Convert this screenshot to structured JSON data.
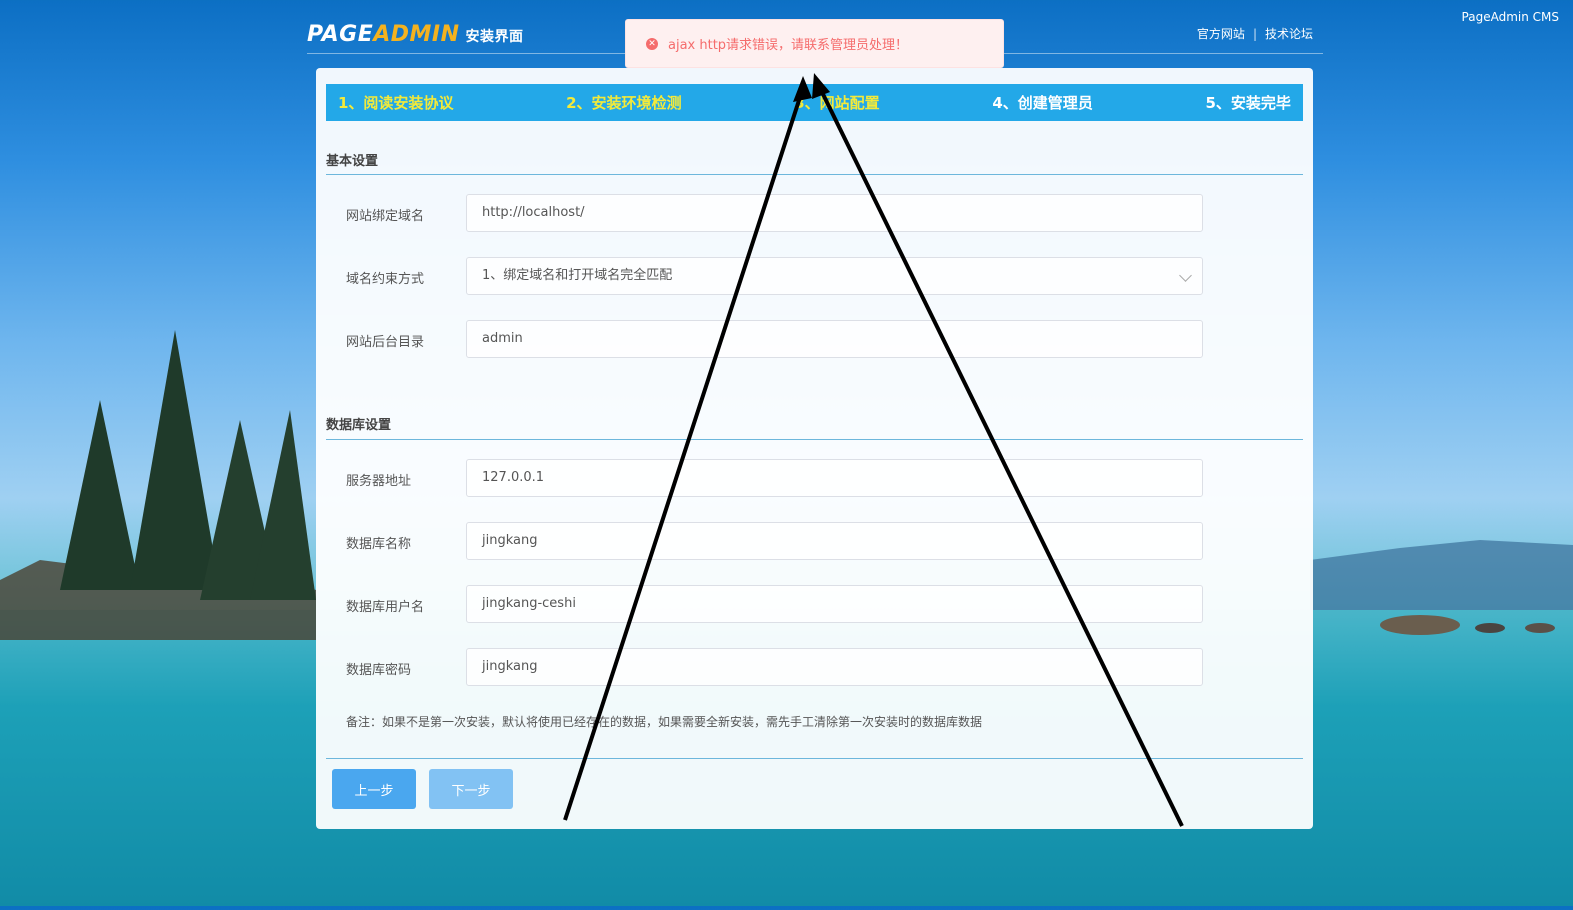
{
  "header": {
    "logo_page": "PAGE",
    "logo_admin": "ADMIN",
    "logo_suffix": "安装界面",
    "links": [
      "官方网站",
      "技术论坛"
    ],
    "brand": "PageAdmin CMS"
  },
  "toast": {
    "icon": "error-icon",
    "message": "ajax http请求错误，请联系管理员处理！",
    "color": "#f56c6c"
  },
  "steps": [
    {
      "label": "1、阅读安装协议",
      "status": "done"
    },
    {
      "label": "2、安装环境检测",
      "status": "done"
    },
    {
      "label": "3、网站配置",
      "status": "current"
    },
    {
      "label": "4、创建管理员",
      "status": "pending"
    },
    {
      "label": "5、安装完毕",
      "status": "pending"
    }
  ],
  "sections": {
    "basic": {
      "title": "基本设置",
      "fields": [
        {
          "label": "网站绑定域名",
          "value": "http://localhost/"
        },
        {
          "label": "域名约束方式",
          "value": "1、绑定域名和打开域名完全匹配"
        },
        {
          "label": "网站后台目录",
          "value": "admin"
        }
      ]
    },
    "database": {
      "title": "数据库设置",
      "fields": [
        {
          "label": "服务器地址",
          "value": "127.0.0.1"
        },
        {
          "label": "数据库名称",
          "value": "jingkang"
        },
        {
          "label": "数据库用户名",
          "value": "jingkang-ceshi"
        },
        {
          "label": "数据库密码",
          "value": "jingkang"
        }
      ]
    }
  },
  "note": "备注：如果不是第一次安装，默认将使用已经存在的数据，如果需要全新安装，需先手工清除第一次安装时的数据库数据",
  "buttons": {
    "prev": "上一步",
    "next": "下一步"
  },
  "colors": {
    "accent": "#23a8e8",
    "step_done": "#f3ea3a",
    "button": "#4aa7ef"
  }
}
